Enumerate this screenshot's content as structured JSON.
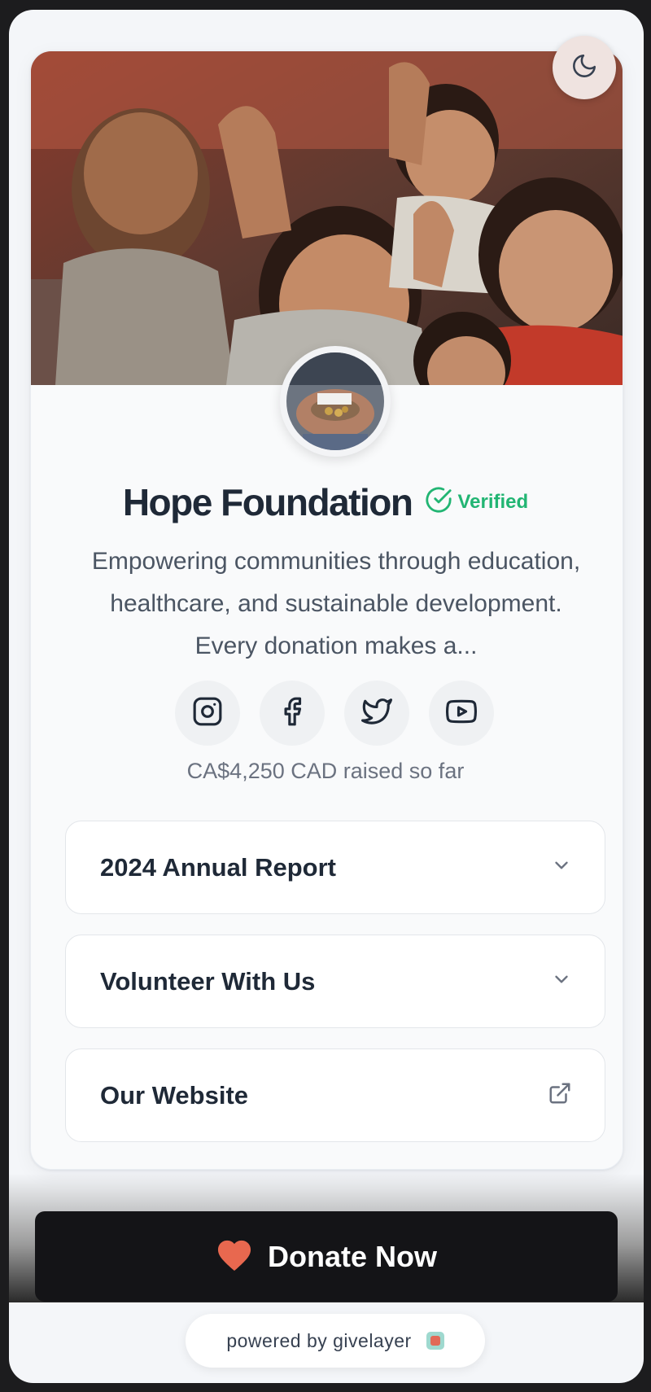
{
  "organization": {
    "name": "Hope Foundation",
    "verified_label": "Verified",
    "description": "Empowering communities through education, healthcare, and sustainable development. Every donation makes a..."
  },
  "socials": [
    {
      "icon": "instagram-icon"
    },
    {
      "icon": "facebook-icon"
    },
    {
      "icon": "twitter-icon"
    },
    {
      "icon": "youtube-icon"
    }
  ],
  "raised_text": "CA$4,250 CAD raised so far",
  "links": [
    {
      "label": "2024 Annual Report",
      "icon": "chevron-down-icon"
    },
    {
      "label": "Volunteer With Us",
      "icon": "chevron-down-icon"
    },
    {
      "label": "Our Website",
      "icon": "external-link-icon"
    }
  ],
  "donate": {
    "label": "Donate Now",
    "icon": "heart-icon",
    "icon_color": "#e8684f"
  },
  "powered_by": {
    "label": "powered by givelayer"
  },
  "colors": {
    "verified": "#22b573",
    "donate_bg": "#141417",
    "text_dark": "#1f2937"
  }
}
